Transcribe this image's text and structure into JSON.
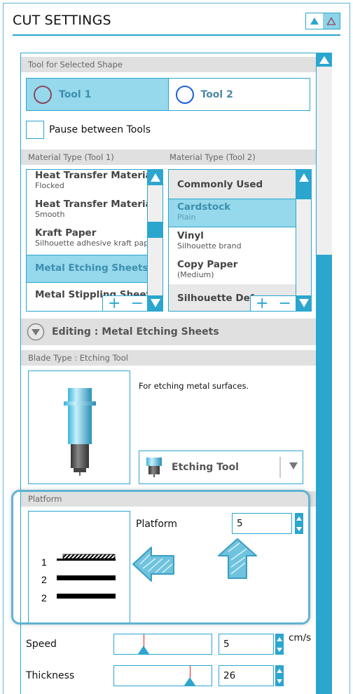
{
  "header": {
    "title": "CUT SETTINGS",
    "buttons": [
      {
        "name": "expand-all",
        "icon": "triangle-up-filled"
      },
      {
        "name": "collapse-all",
        "icon": "triangle-up-outline"
      }
    ]
  },
  "tool_section": {
    "title": "Tool for Selected Shape",
    "tools": [
      {
        "label": "Tool 1",
        "selected": true,
        "ring_color": "#8b4a5c"
      },
      {
        "label": "Tool 2",
        "selected": false,
        "ring_color": "#1a5fe0"
      }
    ],
    "pause_between_tools": {
      "label": "Pause between Tools",
      "checked": false
    }
  },
  "material_tool1": {
    "header": "Material Type (Tool 1)",
    "items": [
      {
        "title": "Heat Transfer Material",
        "subtitle": "Flocked"
      },
      {
        "title": "Heat Transfer Material",
        "subtitle": "Smooth"
      },
      {
        "title": "Kraft Paper",
        "subtitle": "Silhouette adhesive kraft paper"
      },
      {
        "title": "Metal Etching Sheets",
        "subtitle": "",
        "selected": true
      },
      {
        "title": "Metal Stippling Sheets",
        "subtitle": ""
      }
    ]
  },
  "material_tool2": {
    "header": "Material Type (Tool 2)",
    "items": [
      {
        "title": "Commonly Used",
        "subtitle": "",
        "group": true
      },
      {
        "title": "Cardstock",
        "subtitle": "Plain",
        "selected": true
      },
      {
        "title": "Vinyl",
        "subtitle": "Silhouette brand"
      },
      {
        "title": "Copy Paper",
        "subtitle": "(Medium)"
      },
      {
        "title": "Silhouette Defaults",
        "subtitle": "",
        "group": true
      }
    ]
  },
  "list_controls": {
    "add": "+",
    "remove": "−"
  },
  "editing": {
    "label": "Editing : Metal Etching Sheets",
    "blade_header": "Blade Type : Etching Tool",
    "description": "For etching metal surfaces.",
    "blade_dropdown": {
      "selected": "Etching Tool"
    }
  },
  "platform": {
    "header": "Platform",
    "label": "Platform",
    "value": "5",
    "diagram_labels": [
      "1",
      "2",
      "2"
    ]
  },
  "speed": {
    "label": "Speed",
    "value": "5",
    "unit": "cm/s",
    "slider_fraction": 0.3
  },
  "thickness": {
    "label": "Thickness",
    "value": "26",
    "slider_fraction": 0.78
  },
  "colors": {
    "accent": "#2ba6cf",
    "selected_bg": "#96d8ec",
    "header_bg": "#e0e0e0"
  }
}
